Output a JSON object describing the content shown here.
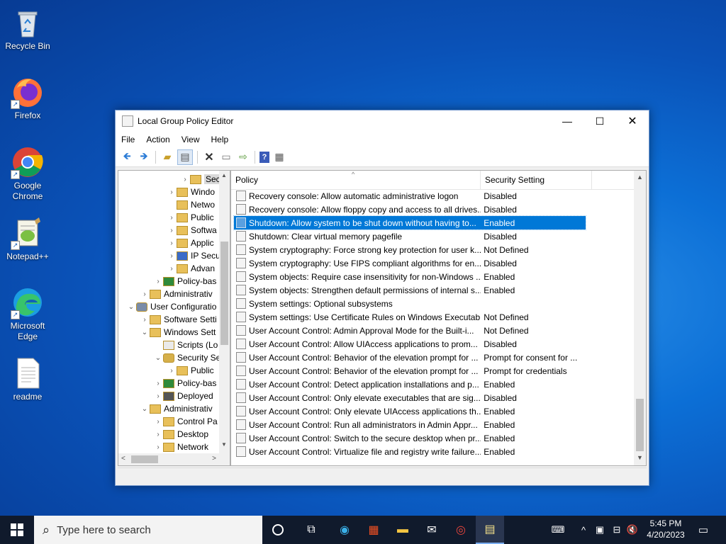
{
  "desktop": {
    "icons": [
      {
        "label": "Recycle Bin",
        "icon": "recycle-bin-icon"
      },
      {
        "label": "Firefox",
        "icon": "firefox-icon"
      },
      {
        "label": "Google Chrome",
        "icon": "chrome-icon"
      },
      {
        "label": "Notepad++",
        "icon": "notepadpp-icon"
      },
      {
        "label": "Microsoft Edge",
        "icon": "edge-icon"
      },
      {
        "label": "readme",
        "icon": "text-file-icon"
      }
    ]
  },
  "window": {
    "title": "Local Group Policy Editor",
    "menu": [
      "File",
      "Action",
      "View",
      "Help"
    ],
    "toolbar": [
      "back-icon",
      "forward-icon",
      "up-folder-icon",
      "show-hide-tree-icon",
      "delete-icon",
      "properties-icon",
      "export-list-icon",
      "help-icon",
      "view-icon"
    ],
    "tree": [
      {
        "label": "Sec",
        "indent": 5,
        "arrow": ">",
        "icon": "security-folder-icon",
        "selected": true
      },
      {
        "label": "Windo",
        "indent": 4,
        "arrow": ">",
        "icon": "folder-icon"
      },
      {
        "label": "Netwo",
        "indent": 4,
        "arrow": "",
        "icon": "folder-icon"
      },
      {
        "label": "Public",
        "indent": 4,
        "arrow": ">",
        "icon": "folder-icon"
      },
      {
        "label": "Softwa",
        "indent": 4,
        "arrow": ">",
        "icon": "folder-icon"
      },
      {
        "label": "Applic",
        "indent": 4,
        "arrow": ">",
        "icon": "folder-icon"
      },
      {
        "label": "IP Secu",
        "indent": 4,
        "arrow": ">",
        "icon": "ipsec-icon"
      },
      {
        "label": "Advan",
        "indent": 4,
        "arrow": ">",
        "icon": "folder-icon"
      },
      {
        "label": "Policy-bas",
        "indent": 3,
        "arrow": ">",
        "icon": "chart-icon"
      },
      {
        "label": "Administrativ",
        "indent": 2,
        "arrow": ">",
        "icon": "folder-icon"
      },
      {
        "label": "User Configuratio",
        "indent": 1,
        "arrow": "v",
        "icon": "user-icon"
      },
      {
        "label": "Software Setti",
        "indent": 2,
        "arrow": ">",
        "icon": "folder-icon"
      },
      {
        "label": "Windows Sett",
        "indent": 2,
        "arrow": "v",
        "icon": "folder-icon"
      },
      {
        "label": "Scripts (Lo",
        "indent": 3,
        "arrow": "",
        "icon": "script-icon"
      },
      {
        "label": "Security Se",
        "indent": 3,
        "arrow": "v",
        "icon": "security-icon"
      },
      {
        "label": "Public",
        "indent": 4,
        "arrow": ">",
        "icon": "folder-icon"
      },
      {
        "label": "Policy-bas",
        "indent": 3,
        "arrow": ">",
        "icon": "chart-icon"
      },
      {
        "label": "Deployed",
        "indent": 3,
        "arrow": ">",
        "icon": "printer-icon"
      },
      {
        "label": "Administrativ",
        "indent": 2,
        "arrow": "v",
        "icon": "folder-icon"
      },
      {
        "label": "Control Pa",
        "indent": 3,
        "arrow": ">",
        "icon": "folder-icon"
      },
      {
        "label": "Desktop",
        "indent": 3,
        "arrow": ">",
        "icon": "folder-icon"
      },
      {
        "label": "Network",
        "indent": 3,
        "arrow": ">",
        "icon": "folder-icon"
      }
    ],
    "list": {
      "columns": [
        "Policy",
        "Security Setting"
      ],
      "rows": [
        {
          "policy": "Recovery console: Allow automatic administrative logon",
          "setting": "Disabled"
        },
        {
          "policy": "Recovery console: Allow floppy copy and access to all drives...",
          "setting": "Disabled"
        },
        {
          "policy": "Shutdown: Allow system to be shut down without having to...",
          "setting": "Enabled",
          "selected": true
        },
        {
          "policy": "Shutdown: Clear virtual memory pagefile",
          "setting": "Disabled"
        },
        {
          "policy": "System cryptography: Force strong key protection for user k...",
          "setting": "Not Defined"
        },
        {
          "policy": "System cryptography: Use FIPS compliant algorithms for en...",
          "setting": "Disabled"
        },
        {
          "policy": "System objects: Require case insensitivity for non-Windows ...",
          "setting": "Enabled"
        },
        {
          "policy": "System objects: Strengthen default permissions of internal s...",
          "setting": "Enabled"
        },
        {
          "policy": "System settings: Optional subsystems",
          "setting": ""
        },
        {
          "policy": "System settings: Use Certificate Rules on Windows Executab...",
          "setting": "Not Defined"
        },
        {
          "policy": "User Account Control: Admin Approval Mode for the Built-i...",
          "setting": "Not Defined"
        },
        {
          "policy": "User Account Control: Allow UIAccess applications to prom...",
          "setting": "Disabled"
        },
        {
          "policy": "User Account Control: Behavior of the elevation prompt for ...",
          "setting": "Prompt for consent for ..."
        },
        {
          "policy": "User Account Control: Behavior of the elevation prompt for ...",
          "setting": "Prompt for credentials"
        },
        {
          "policy": "User Account Control: Detect application installations and p...",
          "setting": "Enabled"
        },
        {
          "policy": "User Account Control: Only elevate executables that are sig...",
          "setting": "Disabled"
        },
        {
          "policy": "User Account Control: Only elevate UIAccess applications th...",
          "setting": "Enabled"
        },
        {
          "policy": "User Account Control: Run all administrators in Admin Appr...",
          "setting": "Enabled"
        },
        {
          "policy": "User Account Control: Switch to the secure desktop when pr...",
          "setting": "Enabled"
        },
        {
          "policy": "User Account Control: Virtualize file and registry write failure...",
          "setting": "Enabled"
        }
      ]
    }
  },
  "taskbar": {
    "search_placeholder": "Type here to search",
    "time": "5:45 PM",
    "date": "4/20/2023",
    "pinned": [
      "cortana-icon",
      "task-view-icon",
      "edge-icon",
      "store-icon",
      "file-explorer-icon",
      "mail-icon",
      "chrome-icon",
      "notepad-icon"
    ]
  },
  "colors": {
    "selection": "#0078d7",
    "taskbar": "#101a2c",
    "desktop": "#0a5cc4"
  }
}
